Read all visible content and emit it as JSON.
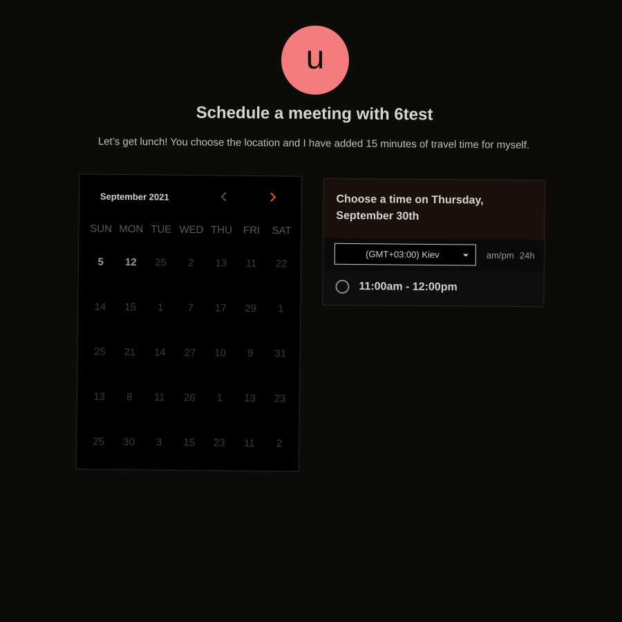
{
  "avatar": {
    "initial": "u",
    "color": "#f47c7c"
  },
  "header": {
    "title": "Schedule a meeting with 6test",
    "description": "Let’s get lunch! You choose the location and I have added 15 minutes of travel time for myself."
  },
  "calendar": {
    "month_label": "September 2021",
    "prev_icon": "chevron-left-icon",
    "next_icon": "chevron-right-icon",
    "accent": "#e0562a",
    "weekdays": [
      "SUN",
      "MON",
      "TUE",
      "WED",
      "THU",
      "FRI",
      "SAT"
    ],
    "days": [
      [
        "5",
        "12",
        "25",
        "2",
        "13",
        "11",
        "22"
      ],
      [
        "14",
        "15",
        "1",
        "7",
        "17",
        "29",
        "1"
      ],
      [
        "25",
        "21",
        "14",
        "27",
        "10",
        "9",
        "31"
      ],
      [
        "13",
        "8",
        "11",
        "26",
        "1",
        "13",
        "23"
      ],
      [
        "25",
        "30",
        "3",
        "15",
        "23",
        "11",
        "2"
      ]
    ],
    "available": [
      [
        0,
        0
      ],
      [
        0,
        1
      ]
    ]
  },
  "slots_panel": {
    "heading_line1": "Choose a time on Thursday,",
    "heading_line2": "September 30th",
    "timezone": "(GMT+03:00) Kiev",
    "format_ampm": "am/pm",
    "format_24h": "24h",
    "slots": [
      {
        "label": "11:00am - 12:00pm",
        "selected": false
      }
    ]
  }
}
